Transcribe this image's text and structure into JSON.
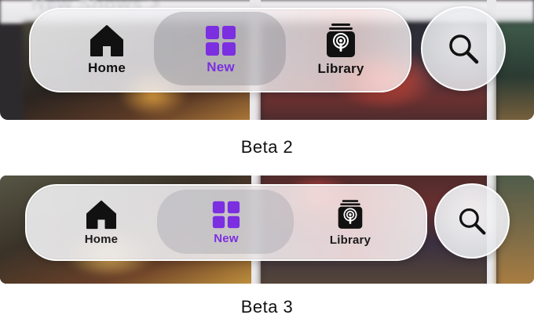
{
  "beta2": {
    "header_partial": "New Shows >",
    "tabs": [
      {
        "label": "Home",
        "icon": "home-icon",
        "active": false
      },
      {
        "label": "New",
        "icon": "grid-icon",
        "active": true
      },
      {
        "label": "Library",
        "icon": "podcasts-library-icon",
        "active": false
      }
    ],
    "search_icon": "search-icon",
    "caption": "Beta 2"
  },
  "beta3": {
    "tabs": [
      {
        "label": "Home",
        "icon": "home-icon",
        "active": false
      },
      {
        "label": "New",
        "icon": "grid-icon",
        "active": true
      },
      {
        "label": "Library",
        "icon": "podcasts-library-icon",
        "active": false
      }
    ],
    "search_icon": "search-icon",
    "caption": "Beta 3"
  },
  "colors": {
    "accent": "#7b2fe0",
    "text": "#111111",
    "background": "#ffffff"
  }
}
